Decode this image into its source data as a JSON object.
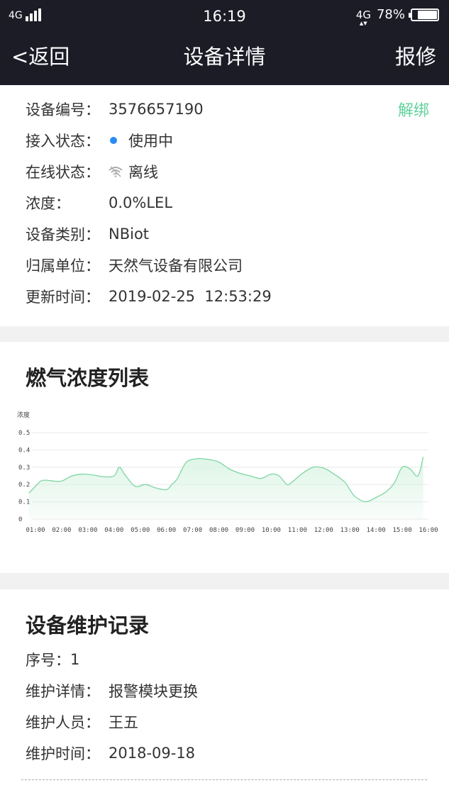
{
  "status_bar": {
    "network_left": "4G",
    "time": "16:19",
    "network_right": "4G",
    "battery": "78%",
    "battery_level": 0.78
  },
  "nav": {
    "back_label": "<返回",
    "title": "设备详情",
    "action_label": "报修"
  },
  "device": {
    "unbind_label": "解绑",
    "rows": [
      {
        "label": "设备编号：",
        "value": "3576657190"
      },
      {
        "label": "接入状态：",
        "value": "使用中",
        "indicator": "blue-dot"
      },
      {
        "label": "在线状态：",
        "value": "离线",
        "indicator": "wifi-off-icon"
      },
      {
        "label": "浓度：",
        "value": "0.0%LEL"
      },
      {
        "label": "设备类别：",
        "value": "NBiot"
      },
      {
        "label": "归属单位：",
        "value": "天然气设备有限公司"
      },
      {
        "label": "更新时间：",
        "value": "2019-02-25  12:53:29"
      }
    ],
    "indicator_color": "#2a8cf0",
    "unbind_color": "#5fd29a"
  },
  "chart_section": {
    "title": "燃气浓度列表"
  },
  "chart_data": {
    "type": "area",
    "title": "",
    "ylabel": "浓度",
    "xlabel": "",
    "ylim": [
      0,
      0.5
    ],
    "y_ticks": [
      "0",
      "0.1",
      "0.2",
      "0.3",
      "0.4",
      "0.5"
    ],
    "x_ticks": [
      "01:00",
      "02:00",
      "03:00",
      "04:00",
      "05:00",
      "06:00",
      "07:00",
      "08:00",
      "09:00",
      "10:00",
      "11:00",
      "12:00",
      "13:00",
      "14:00",
      "15:00",
      "16:00"
    ],
    "grid": true,
    "line_color": "#7fd6a4",
    "fill_color": "#d8f3e2",
    "series": [
      {
        "x": [
          0.75,
          1.0,
          1.2,
          1.4,
          1.7,
          2.0,
          2.4,
          2.8,
          3.2,
          3.6,
          4.0,
          4.2,
          4.4,
          4.8,
          5.2,
          5.6,
          6.0,
          6.2,
          6.4,
          6.6,
          6.8,
          7.2,
          7.6,
          8.0,
          8.4,
          8.8,
          9.2,
          9.6,
          10.0,
          10.3,
          10.6,
          10.8,
          11.2,
          11.6,
          12.0,
          12.4,
          12.8,
          13.0,
          13.2,
          13.6,
          14.0,
          14.4,
          14.7,
          15.0,
          15.3,
          15.6,
          15.8
        ],
        "y": [
          0.15,
          0.19,
          0.22,
          0.225,
          0.22,
          0.22,
          0.25,
          0.26,
          0.255,
          0.245,
          0.25,
          0.3,
          0.26,
          0.19,
          0.2,
          0.18,
          0.17,
          0.2,
          0.23,
          0.29,
          0.335,
          0.35,
          0.345,
          0.33,
          0.29,
          0.265,
          0.25,
          0.235,
          0.26,
          0.25,
          0.2,
          0.215,
          0.265,
          0.3,
          0.295,
          0.26,
          0.215,
          0.17,
          0.13,
          0.1,
          0.125,
          0.16,
          0.21,
          0.3,
          0.29,
          0.25,
          0.36
        ]
      }
    ]
  },
  "maintenance": {
    "title": "设备维护记录",
    "rows": [
      {
        "label": "序号：",
        "value": "1"
      },
      {
        "label": "维护详情：",
        "value": "报警模块更换"
      },
      {
        "label": "维护人员：",
        "value": "王五"
      },
      {
        "label": "维护时间：",
        "value": "2018-09-18"
      }
    ]
  }
}
